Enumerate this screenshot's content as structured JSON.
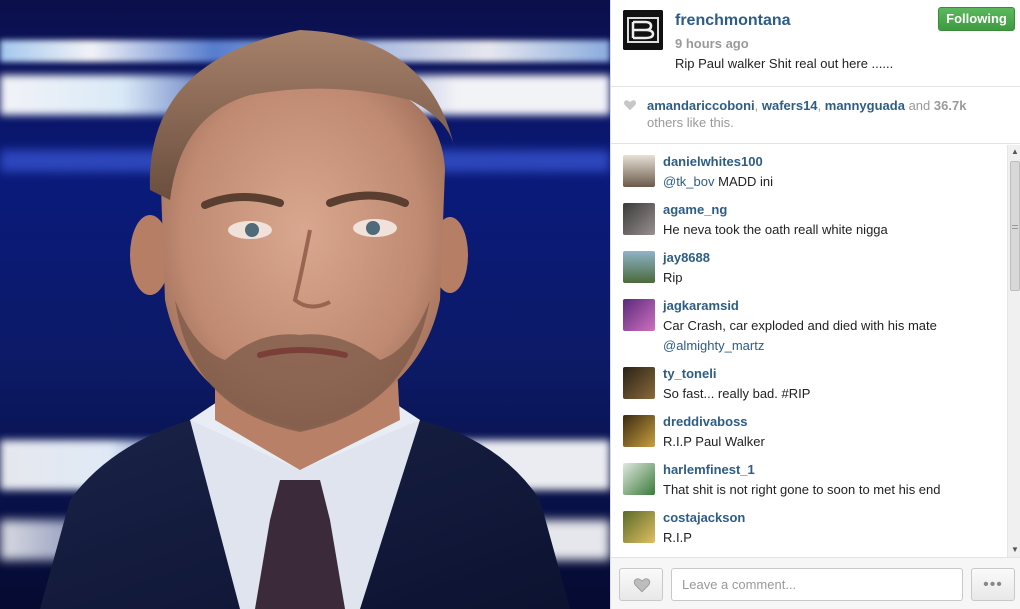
{
  "post": {
    "username": "frenchmontana",
    "follow_label": "Following",
    "timestamp": "9 hours ago",
    "caption": "Rip Paul walker Shit real out here ......"
  },
  "likes": {
    "users": [
      "amandariccoboni",
      "wafers14",
      "mannyguada"
    ],
    "and_text": "and",
    "count": "36.7k",
    "others_text": "others like this."
  },
  "comments": [
    {
      "user": "danielwhites100",
      "mention": "@tk_bov",
      "text": " MADD ini"
    },
    {
      "user": "agame_ng",
      "text": "He neva took the oath reall white nigga"
    },
    {
      "user": "jay8688",
      "text": "Rip"
    },
    {
      "user": "jagkaramsid",
      "text": "Car Crash, car exploded and died with his mate",
      "mention2": "@almighty_martz"
    },
    {
      "user": "ty_toneli",
      "text": "So fast... really bad. #RIP"
    },
    {
      "user": "dreddivaboss",
      "text": "R.I.P Paul Walker"
    },
    {
      "user": "harlemfinest_1",
      "text": "That shit is not right gone to soon to met his end"
    },
    {
      "user": "costajackson",
      "text": "R.I.P"
    }
  ],
  "footer": {
    "comment_placeholder": "Leave a comment...",
    "more_label": "•••"
  },
  "icons": {
    "like": "heart-icon",
    "more": "more-icon"
  },
  "colors": {
    "link": "#2d5d86",
    "follow_green": "#4cae4c",
    "muted": "#999999"
  }
}
